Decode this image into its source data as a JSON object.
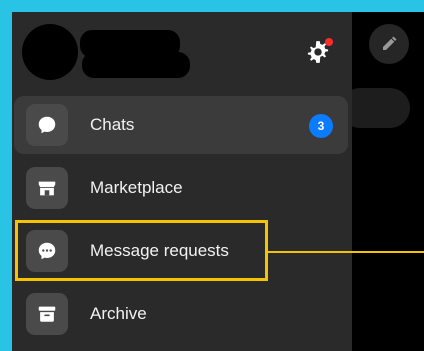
{
  "drawer": {
    "items": [
      {
        "label": "Chats",
        "icon": "chat-bubble-icon",
        "badge": "3",
        "selected": true
      },
      {
        "label": "Marketplace",
        "icon": "storefront-icon"
      },
      {
        "label": "Message requests",
        "icon": "message-requests-icon"
      },
      {
        "label": "Archive",
        "icon": "archive-icon"
      }
    ]
  },
  "colors": {
    "backdrop": "#29c3e6",
    "drawer": "#2a2a2a",
    "selected_row": "#3b3b3b",
    "badge": "#0a7cff",
    "highlight": "#f5c400",
    "notification_dot": "#ff2b2b"
  }
}
